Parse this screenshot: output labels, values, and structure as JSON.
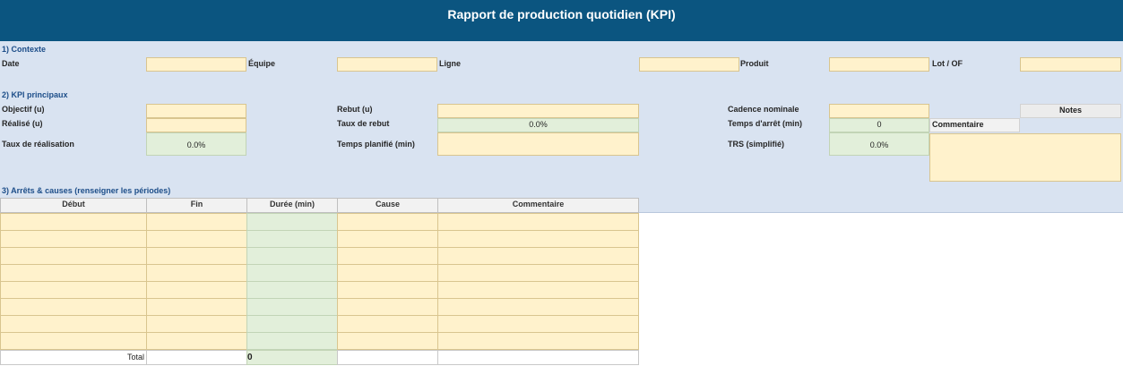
{
  "title": "Rapport de production quotidien (KPI)",
  "section1": {
    "heading": "1) Contexte",
    "labels": {
      "date": "Date",
      "equipe": "Équipe",
      "ligne": "Ligne",
      "produit": "Produit",
      "lot": "Lot / OF"
    }
  },
  "section2": {
    "heading": "2) KPI principaux",
    "labels": {
      "objectif": "Objectif (u)",
      "realise": "Réalisé (u)",
      "taux_realisation": "Taux de réalisation",
      "rebut": "Rebut (u)",
      "taux_rebut": "Taux de rebut",
      "temps_planifie": "Temps planifié (min)",
      "cadence": "Cadence nominale",
      "temps_arret": "Temps d'arrêt (min)",
      "trs": "TRS (simplifié)",
      "notes": "Notes",
      "commentaire": "Commentaire"
    },
    "values": {
      "taux_realisation": "0.0%",
      "taux_rebut": "0.0%",
      "temps_arret": "0",
      "trs": "0.0%"
    }
  },
  "section3": {
    "heading": "3) Arrêts & causes (renseigner les périodes)",
    "columns": [
      "Début",
      "Fin",
      "Durée (min)",
      "Cause",
      "Commentaire"
    ],
    "total_label": "Total",
    "total_duree": "0"
  },
  "colors": {
    "header": "#0b5580",
    "band": "#d9e3f1",
    "input": "#fff2cc",
    "calculated": "#e2efda",
    "section_heading": "#1d4e89"
  }
}
